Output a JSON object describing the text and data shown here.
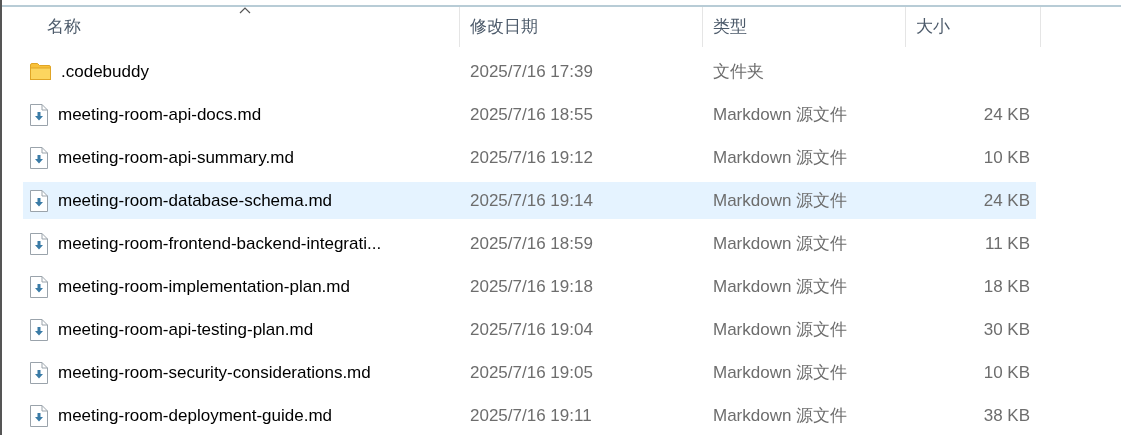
{
  "columns": [
    {
      "label": "名称",
      "sorted": true
    },
    {
      "label": "修改日期",
      "sorted": false
    },
    {
      "label": "类型",
      "sorted": false
    },
    {
      "label": "大小",
      "sorted": false
    }
  ],
  "rows": [
    {
      "kind": "folder",
      "name": ".codebuddy",
      "modified": "2025/7/16 17:39",
      "type": "文件夹",
      "selected": false
    },
    {
      "kind": "file",
      "name": "meeting-room-api-docs.md",
      "modified": "2025/7/16 18:55",
      "type": "Markdown 源文件",
      "size": "24 KB",
      "selected": false
    },
    {
      "kind": "file",
      "name": "meeting-room-api-summary.md",
      "modified": "2025/7/16 19:12",
      "type": "Markdown 源文件",
      "size": "10 KB",
      "selected": false
    },
    {
      "kind": "file",
      "name": "meeting-room-database-schema.md",
      "modified": "2025/7/16 19:14",
      "type": "Markdown 源文件",
      "size": "24 KB",
      "selected": true
    },
    {
      "kind": "file",
      "name": "meeting-room-frontend-backend-integrati...",
      "modified": "2025/7/16 18:59",
      "type": "Markdown 源文件",
      "size": "11 KB",
      "selected": false
    },
    {
      "kind": "file",
      "name": "meeting-room-implementation-plan.md",
      "modified": "2025/7/16 19:18",
      "type": "Markdown 源文件",
      "size": "18 KB",
      "selected": false
    },
    {
      "kind": "file",
      "name": "meeting-room-api-testing-plan.md",
      "modified": "2025/7/16 19:04",
      "type": "Markdown 源文件",
      "size": "30 KB",
      "selected": false
    },
    {
      "kind": "file",
      "name": "meeting-room-security-considerations.md",
      "modified": "2025/7/16 19:05",
      "type": "Markdown 源文件",
      "size": "10 KB",
      "selected": false
    },
    {
      "kind": "file",
      "name": "meeting-room-deployment-guide.md",
      "modified": "2025/7/16 19:11",
      "type": "Markdown 源文件",
      "size": "38 KB",
      "selected": false
    }
  ]
}
